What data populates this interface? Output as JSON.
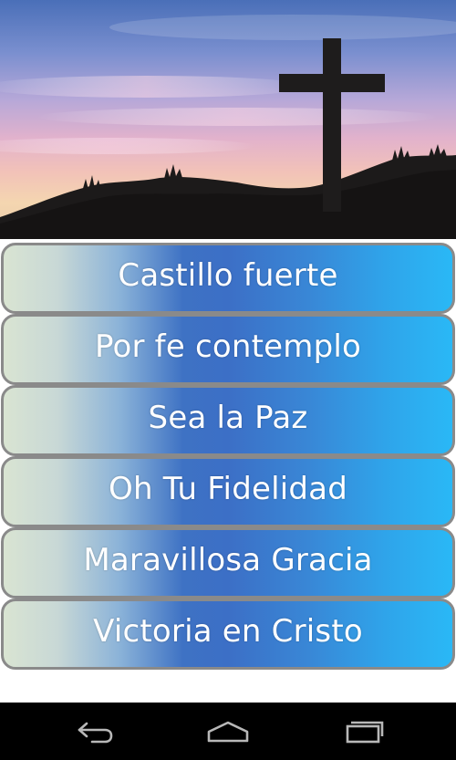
{
  "header_image": {
    "icon": "cross-sunset-image"
  },
  "songs": [
    {
      "label": "Castillo fuerte"
    },
    {
      "label": "Por fe contemplo"
    },
    {
      "label": "Sea la Paz"
    },
    {
      "label": "Oh Tu Fidelidad"
    },
    {
      "label": "Maravillosa Gracia"
    },
    {
      "label": "Victoria en Cristo"
    }
  ],
  "navbar": {
    "back_icon": "back-icon",
    "home_icon": "home-icon",
    "recents_icon": "recent-apps-icon"
  },
  "colors": {
    "button_start": "#d9e4d2",
    "button_mid": "#3c6fc6",
    "button_end": "#2ab8f6",
    "button_border": "#8a8a8a",
    "navbar": "#000000"
  }
}
